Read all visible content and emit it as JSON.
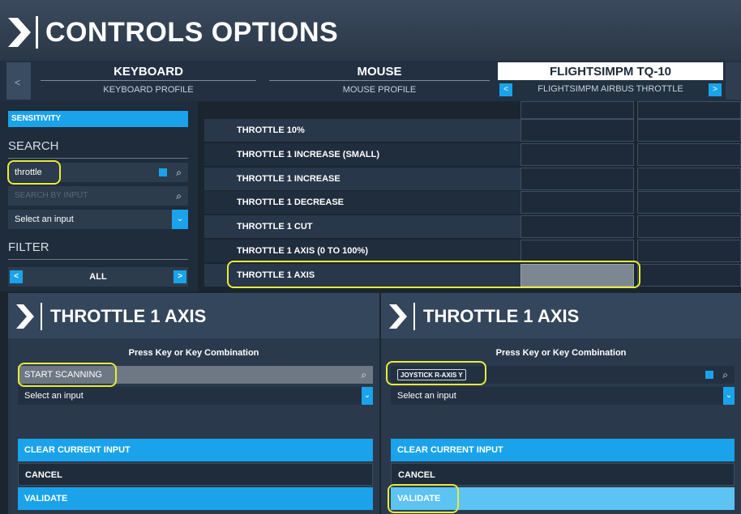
{
  "header": {
    "title": "CONTROLS OPTIONS"
  },
  "tabs": [
    {
      "label": "KEYBOARD",
      "profile": "KEYBOARD PROFILE"
    },
    {
      "label": "MOUSE",
      "profile": "MOUSE PROFILE"
    },
    {
      "label": "FLIGHTSIMPM TQ-10",
      "profile": "FLIGHTSIMPM AIRBUS THROTTLE"
    }
  ],
  "left_panel": {
    "sensitivity_label": "SENSITIVITY",
    "search_heading": "SEARCH",
    "search_value": "throttle",
    "search_by_input_placeholder": "SEARCH BY INPUT",
    "select_input": "Select an input",
    "filter_heading": "FILTER",
    "filter_value": "ALL"
  },
  "actions": [
    "THROTTLE 10%",
    "THROTTLE 1 INCREASE (SMALL)",
    "THROTTLE 1 INCREASE",
    "THROTTLE 1 DECREASE",
    "THROTTLE 1 CUT",
    "THROTTLE 1 AXIS (0 TO 100%)",
    "THROTTLE 1 AXIS"
  ],
  "dialog_left": {
    "title": "THROTTLE 1 AXIS",
    "prompt": "Press Key or Key Combination",
    "scan_value": "START SCANNING",
    "select_input": "Select an input",
    "clear_label": "CLEAR CURRENT INPUT",
    "cancel_label": "CANCEL",
    "validate_label": "VALIDATE"
  },
  "dialog_right": {
    "title": "THROTTLE 1 AXIS",
    "prompt": "Press Key or Key Combination",
    "scan_value": "JOYSTICK R-AXIS Y",
    "select_input": "Select an input",
    "clear_label": "CLEAR CURRENT INPUT",
    "cancel_label": "CANCEL",
    "validate_label": "VALIDATE"
  },
  "colors": {
    "accent": "#1aa3ea",
    "highlight": "#e9ec3a",
    "background": "#1b2530"
  },
  "icons": [
    "chevron-right-icon",
    "search-icon",
    "clear-x-icon",
    "dropdown-arrow-icon",
    "arrow-left-icon",
    "arrow-right-icon"
  ]
}
